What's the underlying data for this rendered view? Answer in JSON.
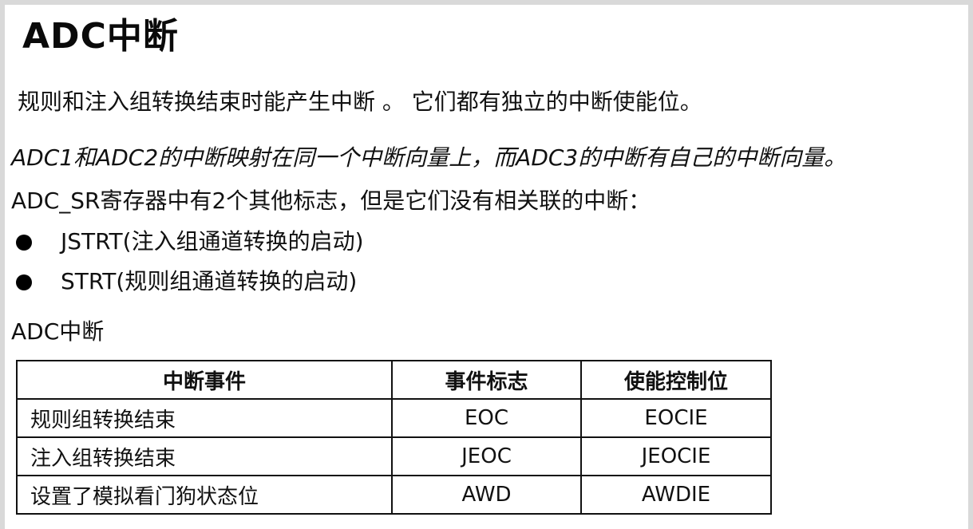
{
  "document": {
    "heading": "ADC中断",
    "paragraph1": "规则和注入组转换结束时能产生中断 。 它们都有独立的中断使能位。",
    "paragraph2": "ADC1和ADC2的中断映射在同一个中断向量上，而ADC3的中断有自己的中断向量。",
    "paragraph3": "ADC_SR寄存器中有2个其他标志，但是它们没有相关联的中断：",
    "bullets": [
      "JSTRT(注入组通道转换的启动)",
      "STRT(规则组通道转换的启动)"
    ],
    "table_caption": "ADC中断",
    "table": {
      "headers": [
        "中断事件",
        "事件标志",
        "使能控制位"
      ],
      "rows": [
        [
          "规则组转换结束",
          "EOC",
          "EOCIE"
        ],
        [
          "注入组转换结束",
          "JEOC",
          "JEOCIE"
        ],
        [
          "设置了模拟看门狗状态位",
          "AWD",
          "AWDIE"
        ]
      ]
    }
  }
}
